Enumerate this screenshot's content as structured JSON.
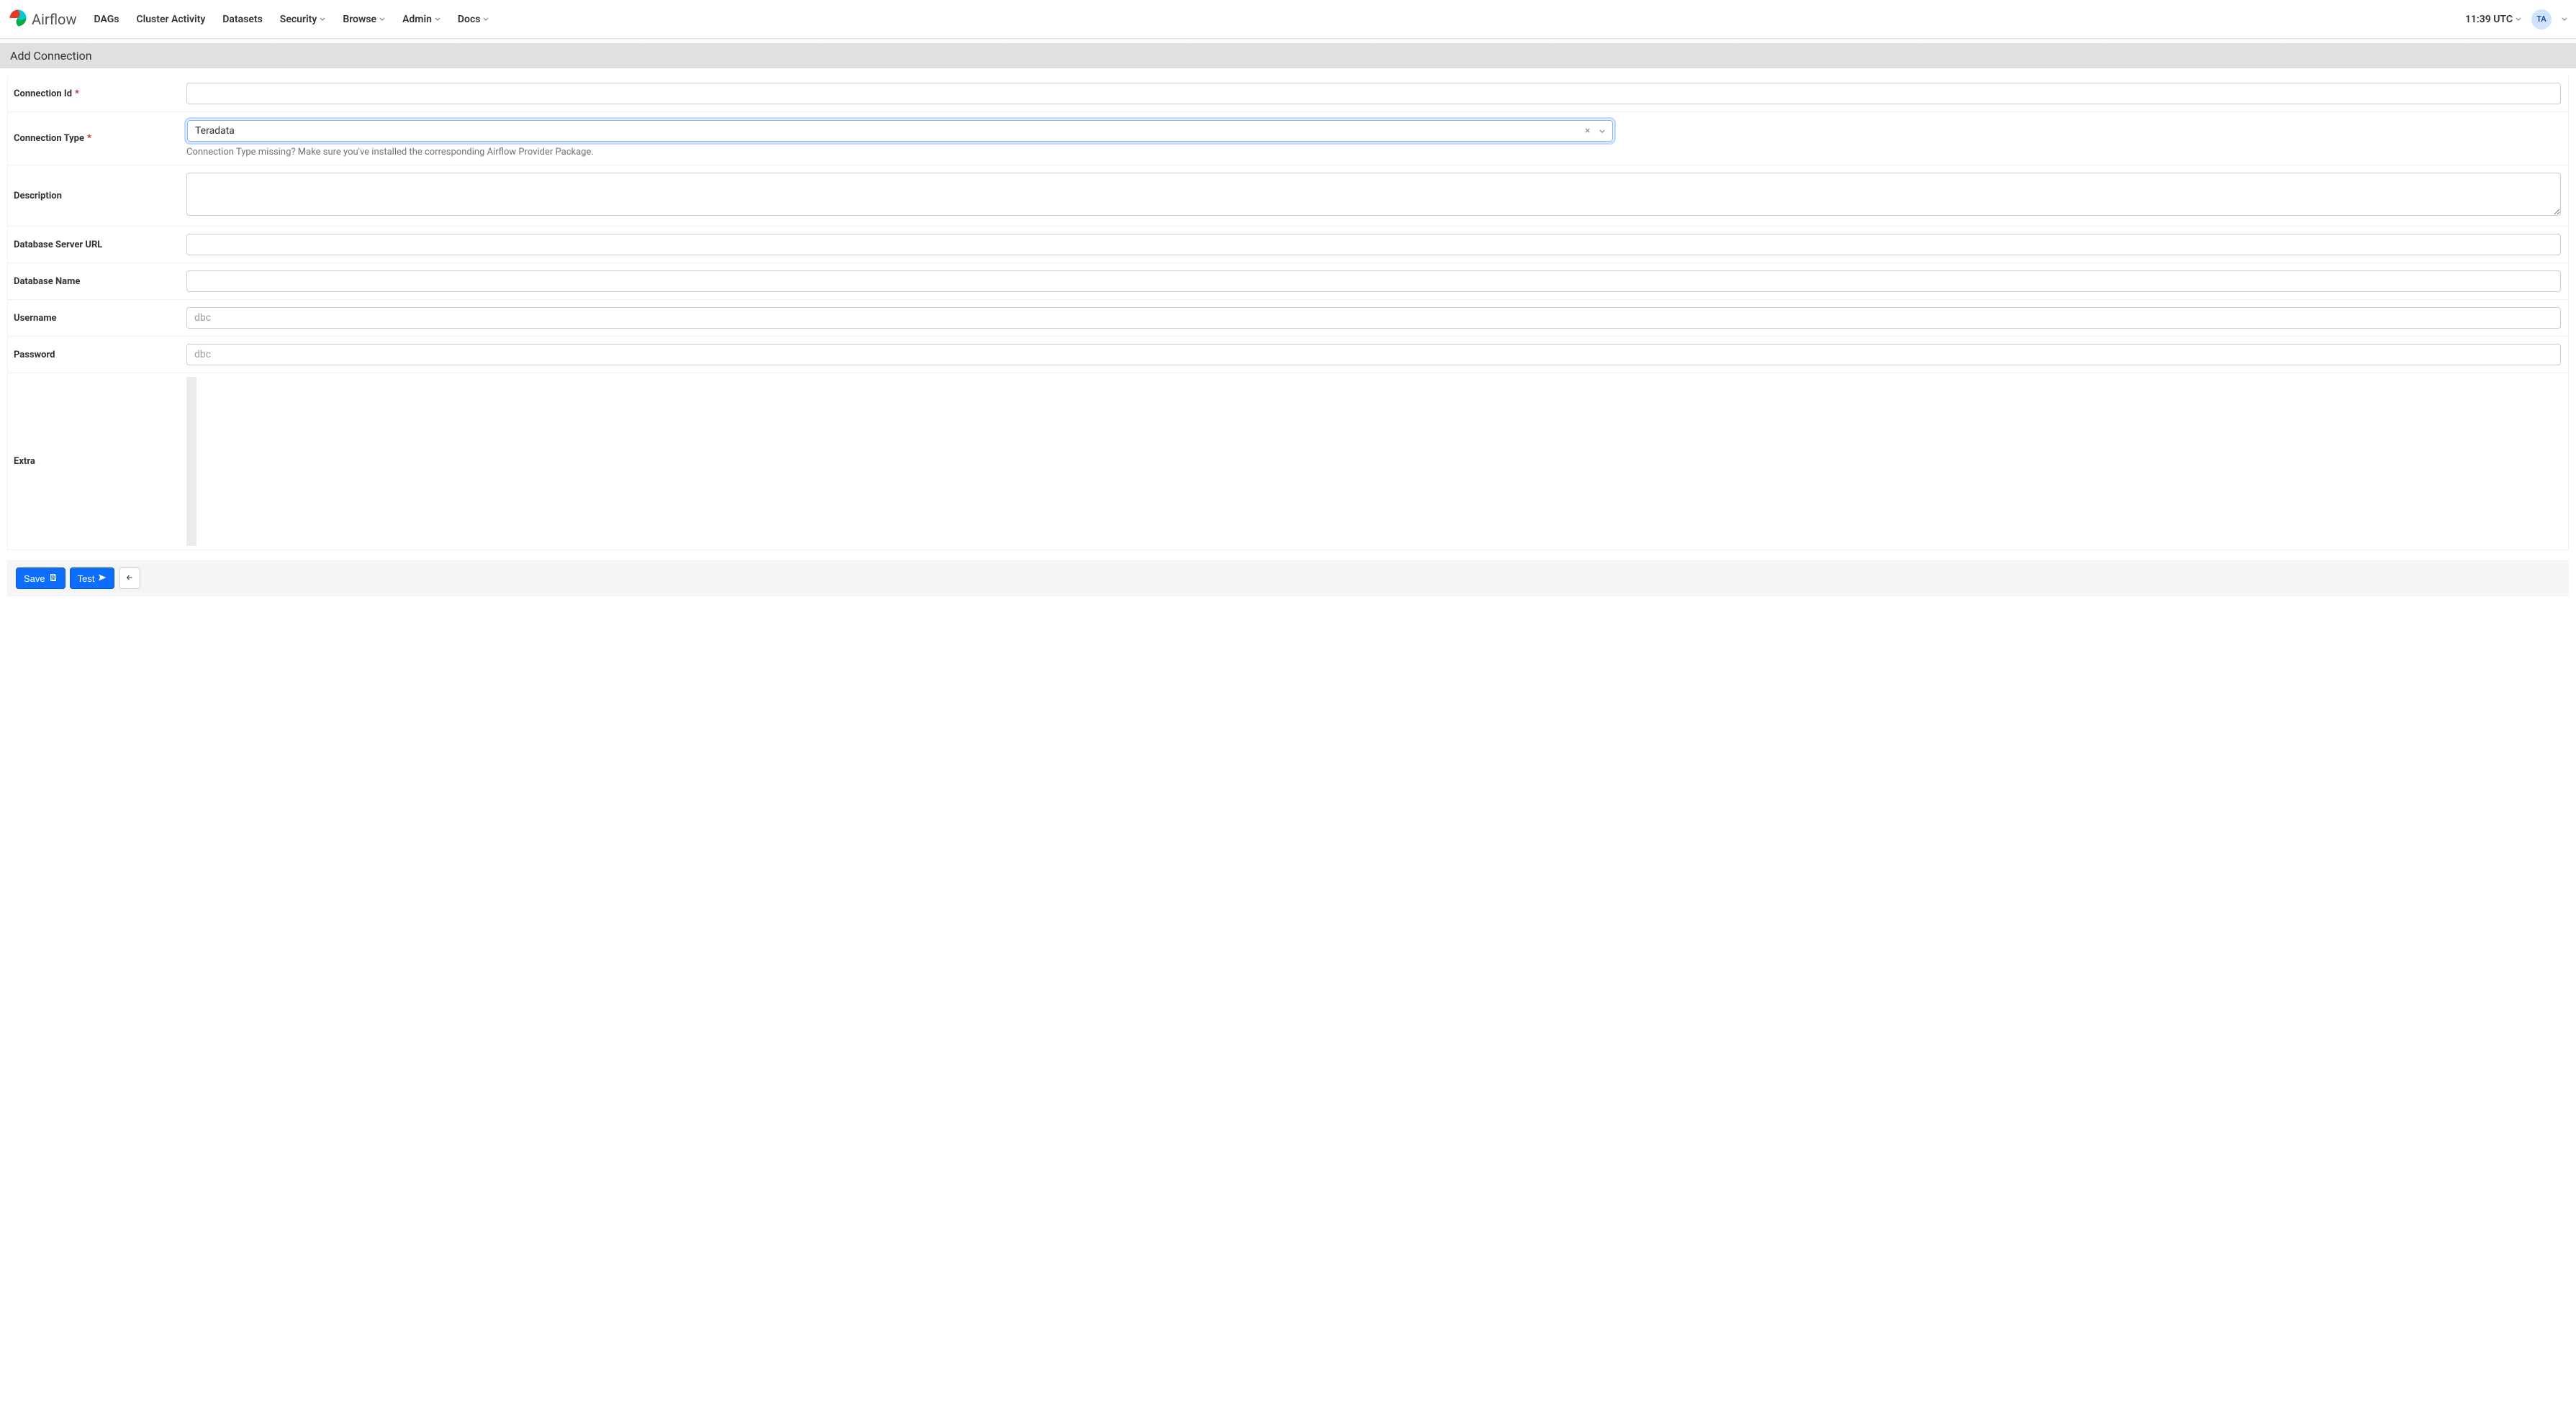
{
  "brand": {
    "name": "Airflow"
  },
  "nav": {
    "items": [
      {
        "label": "DAGs",
        "has_menu": false
      },
      {
        "label": "Cluster Activity",
        "has_menu": false
      },
      {
        "label": "Datasets",
        "has_menu": false
      },
      {
        "label": "Security",
        "has_menu": true
      },
      {
        "label": "Browse",
        "has_menu": true
      },
      {
        "label": "Admin",
        "has_menu": true
      },
      {
        "label": "Docs",
        "has_menu": true
      }
    ],
    "clock": "11:39 UTC",
    "avatar_initials": "TA"
  },
  "page": {
    "title": "Add Connection"
  },
  "form": {
    "connection_id": {
      "label": "Connection Id",
      "required": true,
      "value": ""
    },
    "connection_type": {
      "label": "Connection Type",
      "required": true,
      "selected": "Teradata",
      "help": "Connection Type missing? Make sure you've installed the corresponding Airflow Provider Package."
    },
    "description": {
      "label": "Description",
      "value": ""
    },
    "server_url": {
      "label": "Database Server URL",
      "value": ""
    },
    "database_name": {
      "label": "Database Name",
      "value": ""
    },
    "username": {
      "label": "Username",
      "value": "",
      "placeholder": "dbc"
    },
    "password": {
      "label": "Password",
      "value": "",
      "placeholder": "dbc"
    },
    "extra": {
      "label": "Extra",
      "value": ""
    }
  },
  "actions": {
    "save": "Save",
    "test": "Test"
  }
}
